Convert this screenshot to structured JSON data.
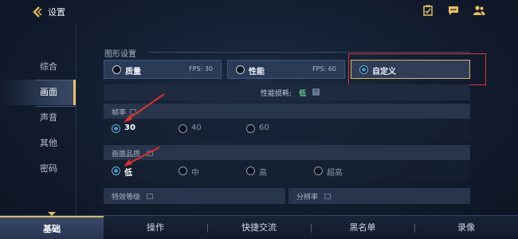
{
  "header": {
    "title": "设置",
    "icons": [
      "back-icon",
      "checklist-icon",
      "chat-icon",
      "friends-icon"
    ]
  },
  "sidebar": {
    "items": [
      {
        "label": "综合"
      },
      {
        "label": "画面"
      },
      {
        "label": "声音"
      },
      {
        "label": "其他"
      },
      {
        "label": "密码"
      }
    ],
    "active_index": 1
  },
  "graphics": {
    "section_title": "图形设置",
    "modes": [
      {
        "label": "质量",
        "fps": "FPS: 30"
      },
      {
        "label": "性能",
        "fps": "FPS: 60"
      },
      {
        "label": "自定义",
        "fps": ""
      }
    ],
    "selected_mode": "自定义",
    "cost_label": "性能损耗:",
    "cost_value": "低"
  },
  "frame_rate": {
    "label": "帧率",
    "options": [
      "30",
      "40",
      "60"
    ],
    "selected": "30"
  },
  "quality": {
    "label": "画面品质",
    "options": [
      "低",
      "中",
      "高",
      "超高"
    ],
    "selected": "低"
  },
  "effects": {
    "label": "特效等级"
  },
  "resolution": {
    "label": "分辨率"
  },
  "bottom_tabs": {
    "items": [
      "基础",
      "操作",
      "快捷交流",
      "黑名单",
      "录像"
    ],
    "active": "基础"
  },
  "colors": {
    "accent_gold": "#e5c061",
    "highlight_red": "#e0373a",
    "cost_green": "#5fd08a",
    "radio_blue": "#3a9ed0"
  }
}
